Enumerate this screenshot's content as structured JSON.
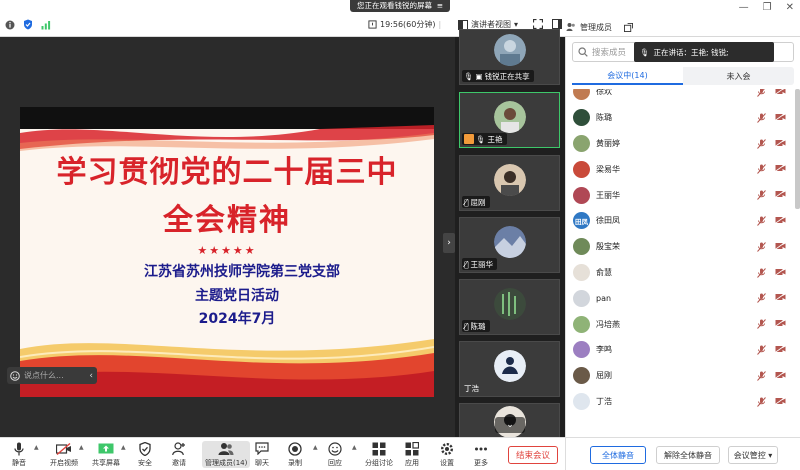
{
  "topbar": {
    "banner": "您正在观看钱锐的屏幕",
    "banner_icon": "menu-icon",
    "duration": "19:56(60分钟)",
    "view_mode": "演讲者视图",
    "panel_title": "管理成员"
  },
  "share": {
    "title_line1": "学习贯彻党的二十届三中",
    "title_line2": "全会精神",
    "stars": "★★★★★",
    "sub_line1": "江苏省苏州技师学院第三党支部",
    "sub_line2": "主题党日活动",
    "sub_line3": "2024年7月",
    "chat_placeholder": "说点什么..."
  },
  "video_strip": {
    "tiles": [
      {
        "label": "钱锐正在共享",
        "avatar_color": "#8fa6b8"
      },
      {
        "label": "王艳",
        "avatar_color": "#a7c49c",
        "active": true
      },
      {
        "label": "屈刚",
        "avatar_color": "#d9c7b0"
      },
      {
        "label": "王丽华",
        "avatar_color": "#6b7fa6"
      },
      {
        "label": "陈璐",
        "avatar_color": "#3c4a3c"
      },
      {
        "label": "丁浩",
        "avatar_color": "#e8eef6"
      }
    ]
  },
  "panel": {
    "search_placeholder": "搜索成员",
    "speaking": "正在讲话：王艳; 钱锐;",
    "tab_in_meeting": "会议中(14)",
    "tab_not_joined": "未入会",
    "members": [
      {
        "name": "徐欢",
        "avatar_color": "#c07b52",
        "initials": ""
      },
      {
        "name": "陈璐",
        "avatar_color": "#2f4f3a",
        "initials": ""
      },
      {
        "name": "黄丽婷",
        "avatar_color": "#8aa46f",
        "initials": ""
      },
      {
        "name": "梁易华",
        "avatar_color": "#c94a3a",
        "initials": ""
      },
      {
        "name": "王丽华",
        "avatar_color": "#b04855",
        "initials": ""
      },
      {
        "name": "徐田凤",
        "avatar_color": "#2f78c4",
        "initials": "田凤"
      },
      {
        "name": "殷宝荣",
        "avatar_color": "#6f8a59",
        "initials": ""
      },
      {
        "name": "俞慧",
        "avatar_color": "#e6e0d8",
        "initials": ""
      },
      {
        "name": "pan",
        "avatar_color": "#d2d6dc",
        "initials": ""
      },
      {
        "name": "冯培燕",
        "avatar_color": "#8fb377",
        "initials": ""
      },
      {
        "name": "李鸣",
        "avatar_color": "#9c7fc1",
        "initials": ""
      },
      {
        "name": "屈刚",
        "avatar_color": "#6a5a48",
        "initials": ""
      },
      {
        "name": "丁浩",
        "avatar_color": "#dfe6ee",
        "initials": ""
      }
    ],
    "mute_all": "全体静音",
    "unmute_all": "解除全体静音",
    "meeting_control": "会议管控"
  },
  "bottombar": {
    "buttons": [
      {
        "label": "静音",
        "icon": "microphone-icon"
      },
      {
        "label": "开启视频",
        "icon": "camera-off-icon"
      },
      {
        "label": "共享屏幕",
        "icon": "share-screen-icon"
      },
      {
        "label": "安全",
        "icon": "shield-icon"
      },
      {
        "label": "邀请",
        "icon": "invite-user-icon"
      },
      {
        "label": "管理成员(14)",
        "icon": "members-icon"
      },
      {
        "label": "聊天",
        "icon": "chat-icon"
      },
      {
        "label": "录制",
        "icon": "record-icon"
      },
      {
        "label": "回应",
        "icon": "reaction-icon"
      },
      {
        "label": "分组讨论",
        "icon": "breakout-icon"
      },
      {
        "label": "应用",
        "icon": "apps-icon"
      },
      {
        "label": "设置",
        "icon": "gear-icon"
      },
      {
        "label": "更多",
        "icon": "more-icon"
      }
    ],
    "end_meeting": "结束会议"
  },
  "colors": {
    "accent": "#1f6be0",
    "danger": "#e0443e",
    "active_tile": "#3ec76a",
    "slide_red": "#d8232a",
    "slide_blue": "#1c1c8c"
  }
}
